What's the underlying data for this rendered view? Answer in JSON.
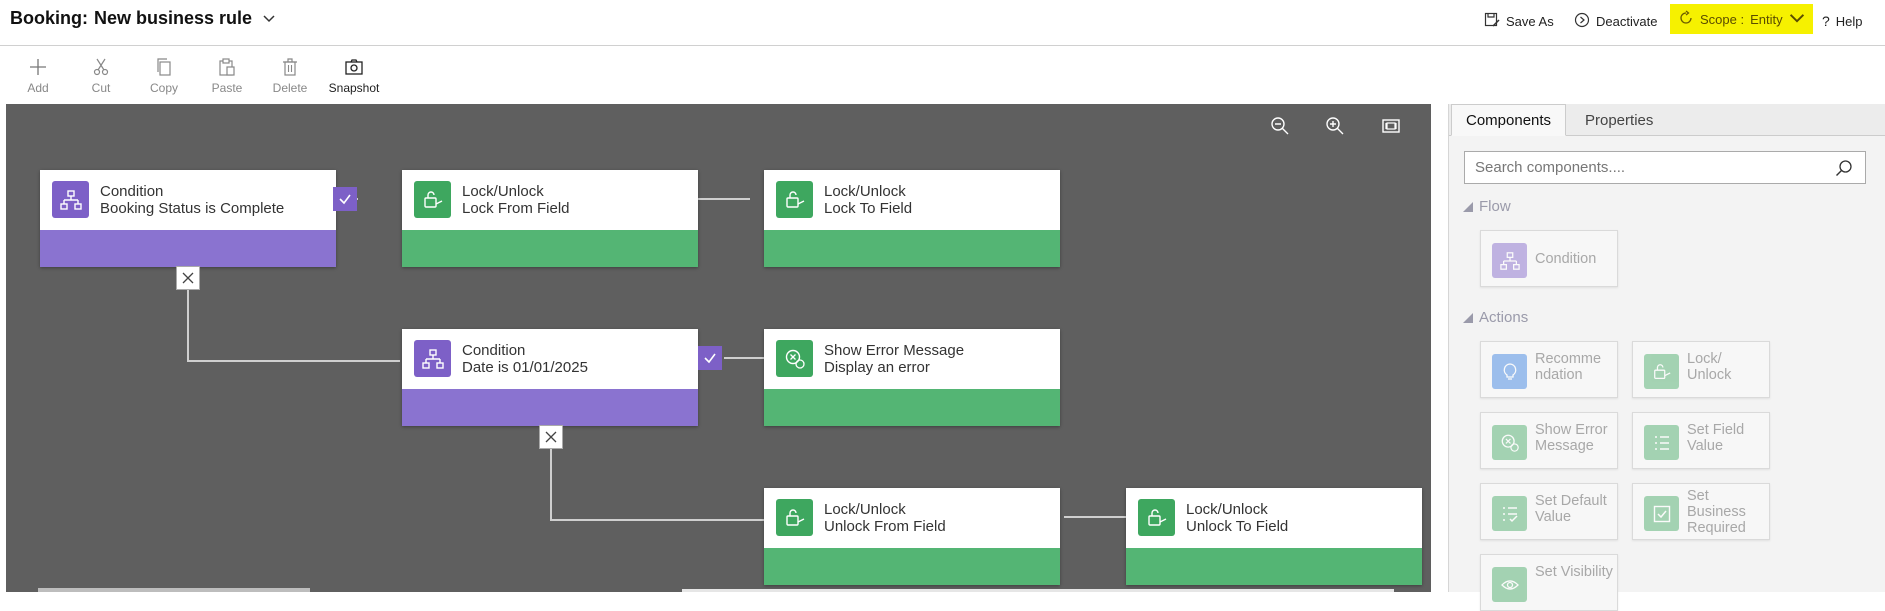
{
  "header": {
    "entity": "Booking:",
    "rule_name": "New business rule",
    "save_as": "Save As",
    "deactivate": "Deactivate",
    "scope_label": "Scope :",
    "scope_value": "Entity",
    "help": "Help"
  },
  "toolbar": {
    "add": "Add",
    "cut": "Cut",
    "copy": "Copy",
    "paste": "Paste",
    "delete": "Delete",
    "snapshot": "Snapshot"
  },
  "canvas": {
    "nodes": [
      {
        "kind": "condition",
        "title": "Condition",
        "subtitle": "Booking Status is Complete"
      },
      {
        "kind": "action",
        "title": "Lock/Unlock",
        "subtitle": "Lock From Field"
      },
      {
        "kind": "action",
        "title": "Lock/Unlock",
        "subtitle": "Lock To Field"
      },
      {
        "kind": "condition",
        "title": "Condition",
        "subtitle": "Date is 01/01/2025"
      },
      {
        "kind": "action",
        "title": "Show Error Message",
        "subtitle": "Display an error"
      },
      {
        "kind": "action",
        "title": "Lock/Unlock",
        "subtitle": "Unlock From Field"
      },
      {
        "kind": "action",
        "title": "Lock/Unlock",
        "subtitle": "Unlock To Field"
      }
    ]
  },
  "panel": {
    "tabs": [
      "Components",
      "Properties"
    ],
    "search_placeholder": "Search components....",
    "flow_header": "Flow",
    "actions_header": "Actions",
    "flow_items": [
      "Condition"
    ],
    "action_items": [
      "Recomme ndation",
      "Lock/ Unlock",
      "Show Error Message",
      "Set Field Value",
      "Set Default Value",
      "Set Business Required",
      "Set Visibility"
    ]
  },
  "colors": {
    "condition": "#7d60c7",
    "condition_bar": "#8a73d0",
    "action": "#3ea75f",
    "action_bar": "#54b574",
    "canvas_bg": "#5f5f5f",
    "scope_highlight": "#f6f100"
  },
  "icons": {
    "save_as": "save-as-icon",
    "deactivate": "deactivate-icon",
    "scope": "scope-icon",
    "help": "help-icon",
    "zoom_out": "zoom-out-icon",
    "zoom_in": "zoom-in-icon",
    "fit": "fit-to-screen-icon"
  }
}
